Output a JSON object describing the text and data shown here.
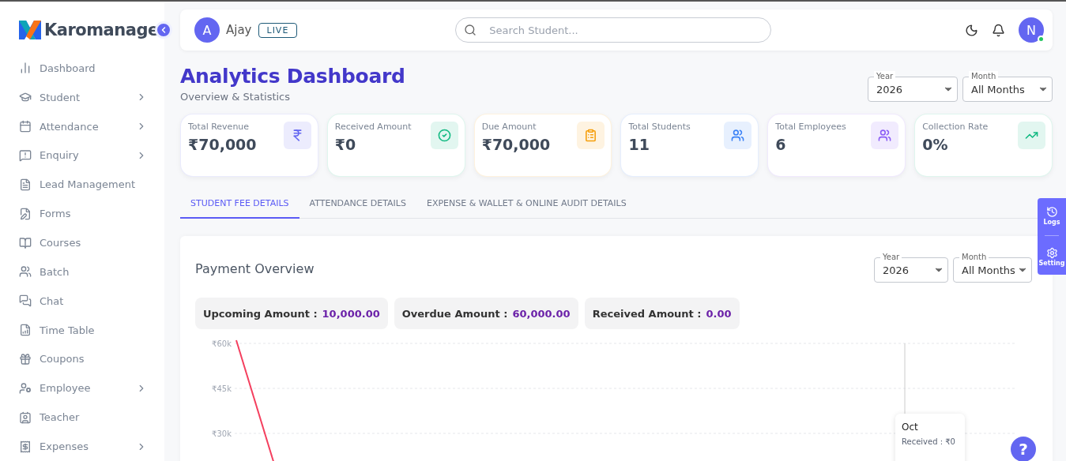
{
  "sidebar": {
    "logo": "Karomanage",
    "collapse_button": true,
    "items": [
      {
        "label": "Dashboard",
        "has_submenu": false
      },
      {
        "label": "Student",
        "has_submenu": true
      },
      {
        "label": "Attendance",
        "has_submenu": true
      },
      {
        "label": "Enquiry",
        "has_submenu": true
      },
      {
        "label": "Lead Management",
        "has_submenu": false
      },
      {
        "label": "Forms",
        "has_submenu": false
      },
      {
        "label": "Courses",
        "has_submenu": false
      },
      {
        "label": "Batch",
        "has_submenu": false
      },
      {
        "label": "Chat",
        "has_submenu": false
      },
      {
        "label": "Time Table",
        "has_submenu": false
      },
      {
        "label": "Coupons",
        "has_submenu": false
      },
      {
        "label": "Employee",
        "has_submenu": true
      },
      {
        "label": "Teacher",
        "has_submenu": false
      },
      {
        "label": "Expenses",
        "has_submenu": true
      }
    ]
  },
  "header": {
    "user_initial": "A",
    "user_name": "Ajay",
    "status_badge": "LIVE",
    "search": {
      "placeholder": "Search Student..."
    },
    "profile_initial": "N",
    "online": true
  },
  "page": {
    "title": "Analytics Dashboard",
    "subtitle": "Overview & Statistics",
    "filters": [
      {
        "label": "Year",
        "value": "2026"
      },
      {
        "label": "Month",
        "value": "All Months"
      }
    ]
  },
  "stats": [
    {
      "label": "Total Revenue",
      "value": "₹70,000",
      "color": "#6366f1"
    },
    {
      "label": "Received Amount",
      "value": "₹0",
      "color": "#10b981"
    },
    {
      "label": "Due Amount",
      "value": "₹70,000",
      "color": "#f59e0b"
    },
    {
      "label": "Total Students",
      "value": "11",
      "color": "#3b82f6"
    },
    {
      "label": "Total Employees",
      "value": "6",
      "color": "#8b5cf6"
    },
    {
      "label": "Collection Rate",
      "value": "0%",
      "color": "#10b981"
    }
  ],
  "tabs": [
    {
      "label": "STUDENT FEE DETAILS",
      "selected": true
    },
    {
      "label": "ATTENDANCE DETAILS",
      "selected": false
    },
    {
      "label": "EXPENSE & WALLET & ONLINE AUDIT DETAILS",
      "selected": false
    }
  ],
  "payment_overview": {
    "title": "Payment Overview",
    "filters": [
      {
        "label": "Year",
        "value": "2026"
      },
      {
        "label": "Month",
        "value": "All Months"
      }
    ],
    "summaries": [
      {
        "label": "Upcoming Amount :",
        "value": "10,000.00"
      },
      {
        "label": "Overdue Amount :",
        "value": "60,000.00"
      },
      {
        "label": "Received Amount :",
        "value": "0.00"
      }
    ],
    "y_axis_labels": [
      "₹60k",
      "₹45k",
      "₹30k"
    ],
    "tooltip": {
      "title": "Oct",
      "lines": [
        "Received : ₹0"
      ]
    }
  },
  "side_panel": [
    {
      "label": "Logs"
    },
    {
      "label": "Setting"
    }
  ],
  "help_button": {
    "label": "?"
  }
}
